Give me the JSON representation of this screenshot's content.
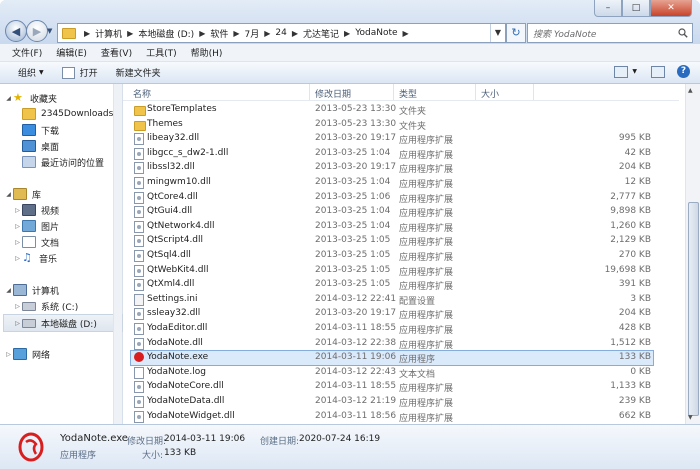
{
  "window": {
    "controls": [
      "–",
      "□",
      "✕"
    ]
  },
  "address": {
    "crumbs": [
      "计算机",
      "本地磁盘 (D:)",
      "软件",
      "7月",
      "24",
      "尤达笔记",
      "YodaNote"
    ]
  },
  "search": {
    "placeholder": "搜索 YodaNote"
  },
  "menu": {
    "items": [
      "文件(F)",
      "编辑(E)",
      "查看(V)",
      "工具(T)",
      "帮助(H)"
    ]
  },
  "toolbar": {
    "organize": "组织",
    "open": "打开",
    "new_folder": "新建文件夹"
  },
  "nav": {
    "favorites": "收藏夹",
    "fav_items": [
      "2345Downloads",
      "下载",
      "桌面",
      "最近访问的位置"
    ],
    "libraries": "库",
    "lib_items": [
      "视频",
      "图片",
      "文档",
      "音乐"
    ],
    "computer": "计算机",
    "comp_items": [
      "系统 (C:)",
      "本地磁盘 (D:)"
    ],
    "network": "网络"
  },
  "columns": {
    "name": "名称",
    "date": "修改日期",
    "type": "类型",
    "size": "大小"
  },
  "files": [
    {
      "name": "StoreTemplates",
      "date": "2013-05-23 13:30",
      "type": "文件夹",
      "size": "",
      "icon": "folder"
    },
    {
      "name": "Themes",
      "date": "2013-05-23 13:30",
      "type": "文件夹",
      "size": "",
      "icon": "folder"
    },
    {
      "name": "libeay32.dll",
      "date": "2013-03-20 19:17",
      "type": "应用程序扩展",
      "size": "995 KB",
      "icon": "dll"
    },
    {
      "name": "libgcc_s_dw2-1.dll",
      "date": "2013-03-25 1:04",
      "type": "应用程序扩展",
      "size": "42 KB",
      "icon": "dll"
    },
    {
      "name": "libssl32.dll",
      "date": "2013-03-20 19:17",
      "type": "应用程序扩展",
      "size": "204 KB",
      "icon": "dll"
    },
    {
      "name": "mingwm10.dll",
      "date": "2013-03-25 1:04",
      "type": "应用程序扩展",
      "size": "12 KB",
      "icon": "dll"
    },
    {
      "name": "QtCore4.dll",
      "date": "2013-03-25 1:06",
      "type": "应用程序扩展",
      "size": "2,777 KB",
      "icon": "dll"
    },
    {
      "name": "QtGui4.dll",
      "date": "2013-03-25 1:04",
      "type": "应用程序扩展",
      "size": "9,898 KB",
      "icon": "dll"
    },
    {
      "name": "QtNetwork4.dll",
      "date": "2013-03-25 1:04",
      "type": "应用程序扩展",
      "size": "1,260 KB",
      "icon": "dll"
    },
    {
      "name": "QtScript4.dll",
      "date": "2013-03-25 1:05",
      "type": "应用程序扩展",
      "size": "2,129 KB",
      "icon": "dll"
    },
    {
      "name": "QtSql4.dll",
      "date": "2013-03-25 1:05",
      "type": "应用程序扩展",
      "size": "270 KB",
      "icon": "dll"
    },
    {
      "name": "QtWebKit4.dll",
      "date": "2013-03-25 1:05",
      "type": "应用程序扩展",
      "size": "19,698 KB",
      "icon": "dll"
    },
    {
      "name": "QtXml4.dll",
      "date": "2013-03-25 1:05",
      "type": "应用程序扩展",
      "size": "391 KB",
      "icon": "dll"
    },
    {
      "name": "Settings.ini",
      "date": "2014-03-12 22:41",
      "type": "配置设置",
      "size": "3 KB",
      "icon": "ini"
    },
    {
      "name": "ssleay32.dll",
      "date": "2013-03-20 19:17",
      "type": "应用程序扩展",
      "size": "204 KB",
      "icon": "dll"
    },
    {
      "name": "YodaEditor.dll",
      "date": "2014-03-11 18:55",
      "type": "应用程序扩展",
      "size": "428 KB",
      "icon": "dll"
    },
    {
      "name": "YodaNote.dll",
      "date": "2014-03-12 22:38",
      "type": "应用程序扩展",
      "size": "1,512 KB",
      "icon": "dll"
    },
    {
      "name": "YodaNote.exe",
      "date": "2014-03-11 19:06",
      "type": "应用程序",
      "size": "133 KB",
      "icon": "exe",
      "selected": true
    },
    {
      "name": "YodaNote.log",
      "date": "2014-03-12 22:43",
      "type": "文本文档",
      "size": "0 KB",
      "icon": "log"
    },
    {
      "name": "YodaNoteCore.dll",
      "date": "2014-03-11 18:55",
      "type": "应用程序扩展",
      "size": "1,133 KB",
      "icon": "dll"
    },
    {
      "name": "YodaNoteData.dll",
      "date": "2014-03-12 21:19",
      "type": "应用程序扩展",
      "size": "239 KB",
      "icon": "dll"
    },
    {
      "name": "YodaNoteWidget.dll",
      "date": "2014-03-11 18:56",
      "type": "应用程序扩展",
      "size": "662 KB",
      "icon": "dll"
    }
  ],
  "details": {
    "filename": "YodaNote.exe",
    "modified_label": "修改日期:",
    "modified_value": "2014-03-11 19:06",
    "created_label": "创建日期:",
    "created_value": "2020-07-24 16:19",
    "type": "应用程序",
    "size_label": "大小:",
    "size_value": "133 KB"
  },
  "colors": {
    "accent": "#2a6bc0",
    "selection": "#dbeafb"
  }
}
